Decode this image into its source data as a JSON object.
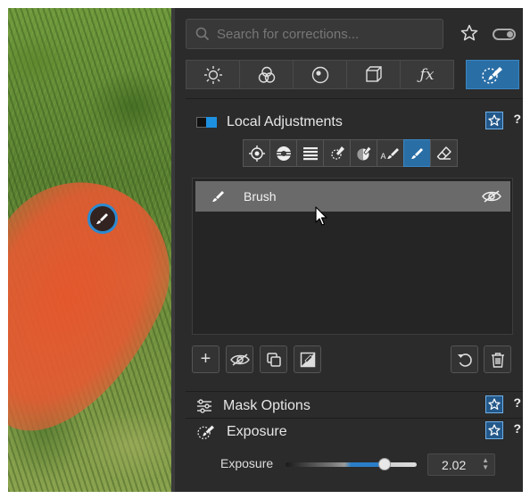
{
  "search": {
    "placeholder": "Search for corrections..."
  },
  "tool_tabs": [
    {
      "icon": "brightness-icon"
    },
    {
      "icon": "color-circles-icon"
    },
    {
      "icon": "lens-dot-icon"
    },
    {
      "icon": "geometry-cube-icon"
    },
    {
      "icon": "fx-icon",
      "label": "ƒx"
    },
    {
      "icon": "local-adjust-brush-icon",
      "active": true
    }
  ],
  "local_adjustments": {
    "title": "Local Adjustments",
    "help": "?",
    "tools": [
      {
        "icon": "control-point-icon"
      },
      {
        "icon": "graduated-filter-icon"
      },
      {
        "icon": "gradient-lines-icon"
      },
      {
        "icon": "auto-mask-icon"
      },
      {
        "icon": "luminosity-mask-icon"
      },
      {
        "icon": "auto-brush-icon",
        "label": "A"
      },
      {
        "icon": "brush-icon",
        "active": true
      },
      {
        "icon": "eraser-icon"
      }
    ],
    "masks": [
      {
        "label": "Brush",
        "selected": true
      }
    ]
  },
  "actions": {
    "add": "+"
  },
  "mask_options": {
    "title": "Mask Options",
    "help": "?"
  },
  "exposure_section": {
    "title": "Exposure",
    "help": "?"
  },
  "exposure_slider": {
    "label": "Exposure",
    "value": "2.02",
    "position_fraction": 0.74
  },
  "colors": {
    "accent": "#2a6ea6",
    "panel_bg": "#2b2b2b",
    "mask_overlay": "#e8552d"
  }
}
